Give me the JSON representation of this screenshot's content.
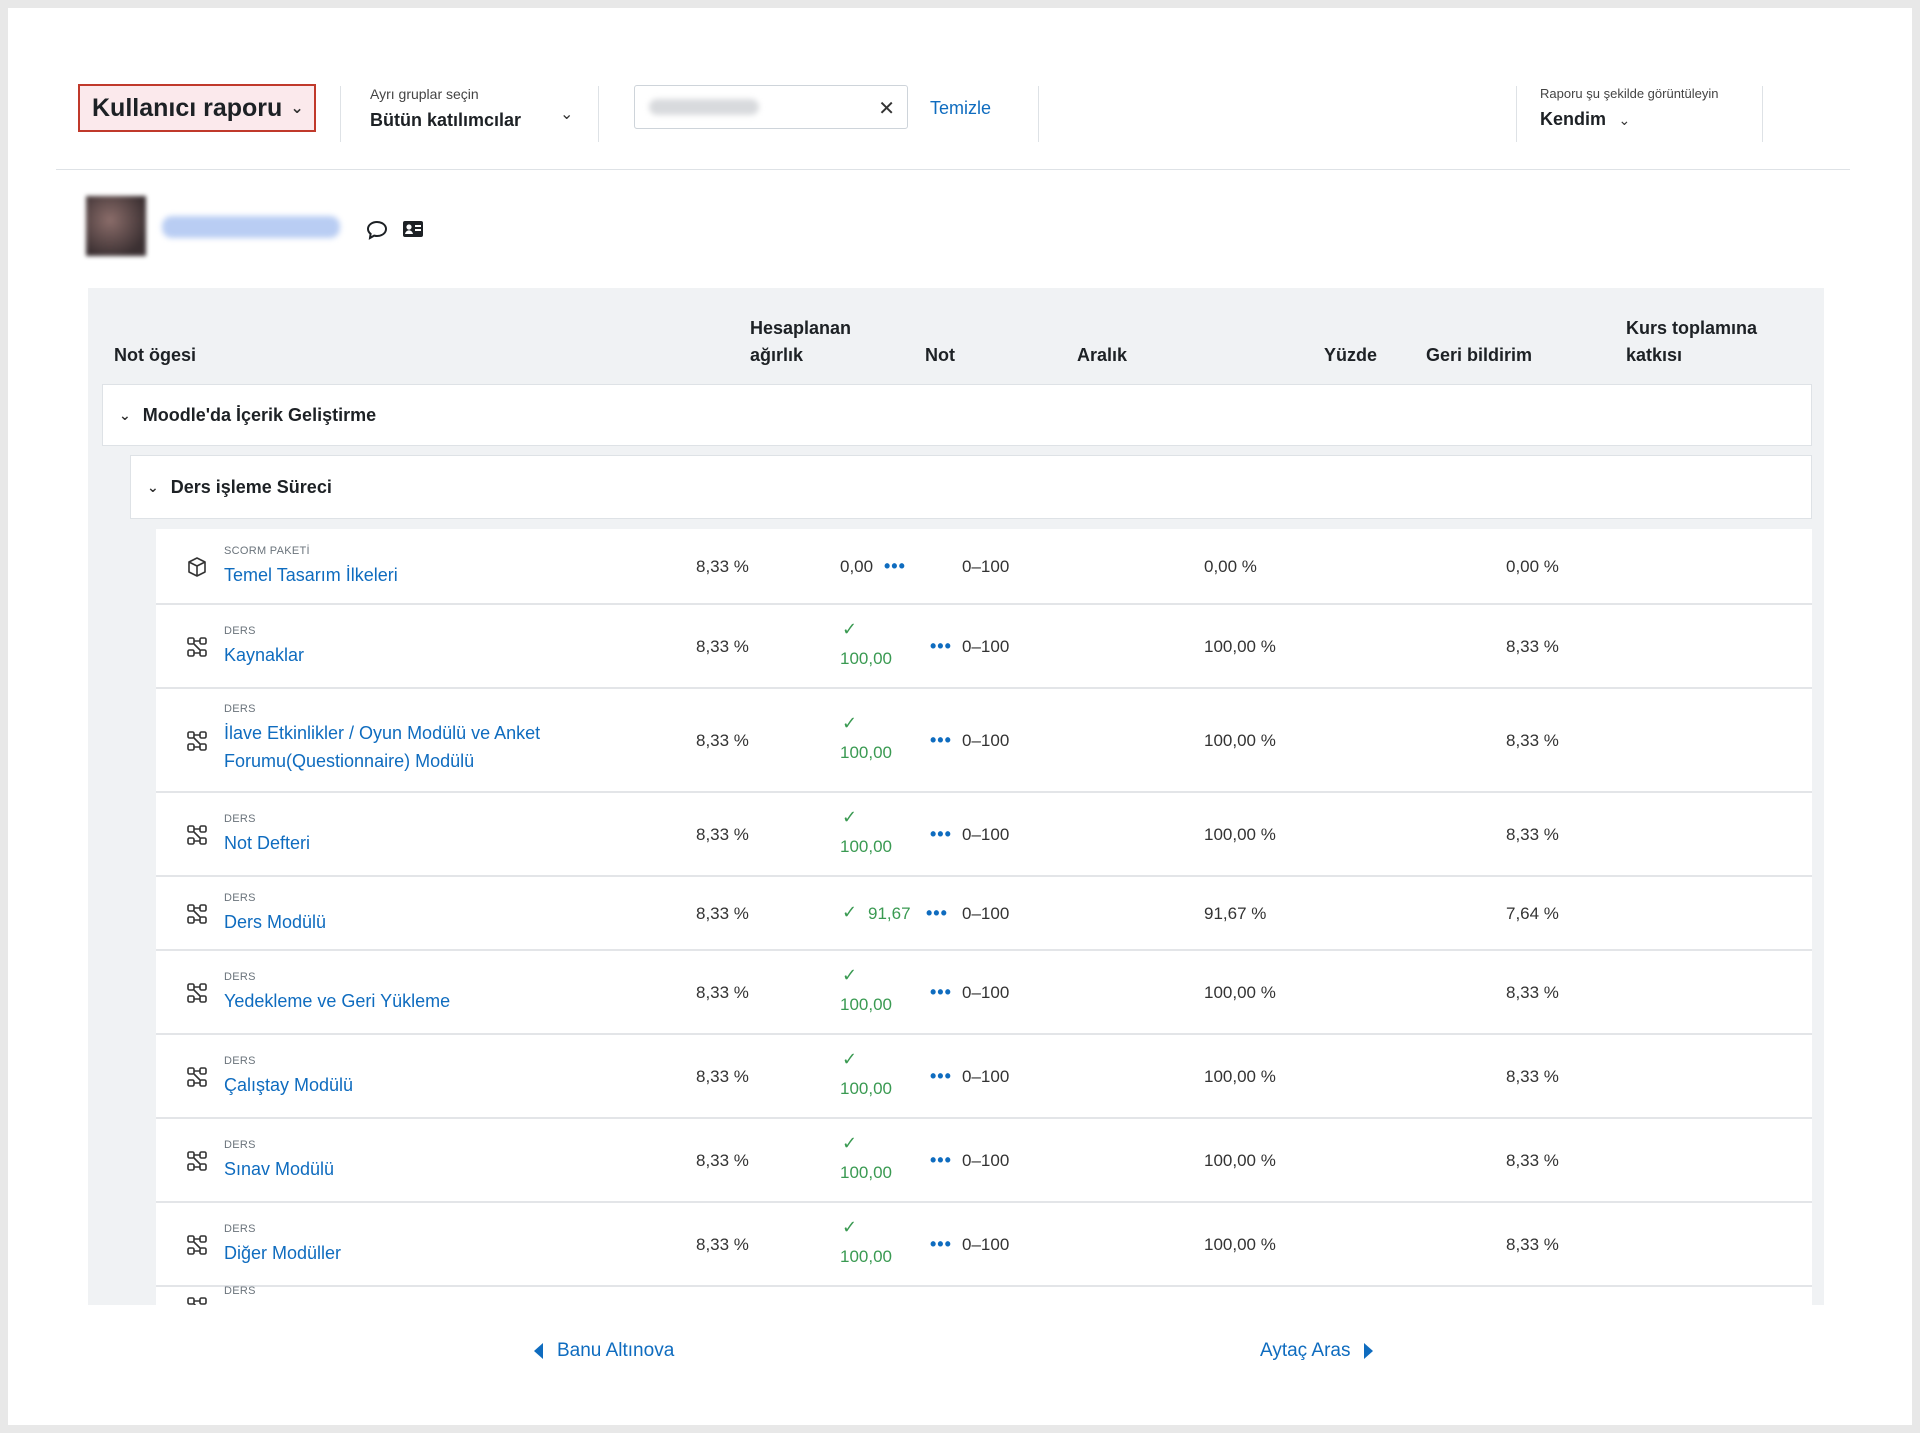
{
  "topbar": {
    "report_select": "Kullanıcı raporu",
    "groups_label": "Ayrı gruplar seçin",
    "groups_value": "Bütün katılımcılar",
    "clear_label": "Temizle",
    "view_as_label": "Raporu şu şekilde görüntüleyin",
    "view_as_value": "Kendim"
  },
  "table": {
    "headers": {
      "item": "Not ögesi",
      "weight_line1": "Hesaplanan",
      "weight_line2": "ağırlık",
      "grade": "Not",
      "range": "Aralık",
      "percentage": "Yüzde",
      "feedback": "Geri bildirim",
      "contribution_line1": "Kurs toplamına",
      "contribution_line2": "katkısı"
    },
    "category": "Moodle'da İçerik Geliştirme",
    "subcategory": "Ders işleme Süreci",
    "rows": [
      {
        "type": "SCORM PAKETİ",
        "name": "Temel Tasarım İlkeleri",
        "weight": "8,33 %",
        "grade": "0,00",
        "range": "0–100",
        "percentage": "0,00 %",
        "contribution": "0,00 %"
      },
      {
        "type": "DERS",
        "name": "Kaynaklar",
        "weight": "8,33 %",
        "grade": "100,00",
        "range": "0–100",
        "percentage": "100,00 %",
        "contribution": "8,33 %"
      },
      {
        "type": "DERS",
        "name": "İlave Etkinlikler / Oyun Modülü ve Anket Forumu(Questionnaire) Modülü",
        "weight": "8,33 %",
        "grade": "100,00",
        "range": "0–100",
        "percentage": "100,00 %",
        "contribution": "8,33 %"
      },
      {
        "type": "DERS",
        "name": "Not Defteri",
        "weight": "8,33 %",
        "grade": "100,00",
        "range": "0–100",
        "percentage": "100,00 %",
        "contribution": "8,33 %"
      },
      {
        "type": "DERS",
        "name": "Ders Modülü",
        "weight": "8,33 %",
        "grade": "91,67",
        "range": "0–100",
        "percentage": "91,67 %",
        "contribution": "7,64 %"
      },
      {
        "type": "DERS",
        "name": "Yedekleme ve Geri Yükleme",
        "weight": "8,33 %",
        "grade": "100,00",
        "range": "0–100",
        "percentage": "100,00 %",
        "contribution": "8,33 %"
      },
      {
        "type": "DERS",
        "name": "Çalıştay Modülü",
        "weight": "8,33 %",
        "grade": "100,00",
        "range": "0–100",
        "percentage": "100,00 %",
        "contribution": "8,33 %"
      },
      {
        "type": "DERS",
        "name": "Sınav Modülü",
        "weight": "8,33 %",
        "grade": "100,00",
        "range": "0–100",
        "percentage": "100,00 %",
        "contribution": "8,33 %"
      },
      {
        "type": "DERS",
        "name": "Diğer Modüller",
        "weight": "8,33 %",
        "grade": "100,00",
        "range": "0–100",
        "percentage": "100,00 %",
        "contribution": "8,33 %"
      },
      {
        "type": "DERS"
      }
    ]
  },
  "footer": {
    "prev_user": "Banu Altınova",
    "next_user": "Aytaç Aras"
  },
  "colors": {
    "link": "#0f6cbf",
    "success": "#3a9a52",
    "report_select_border": "#c0392b"
  }
}
